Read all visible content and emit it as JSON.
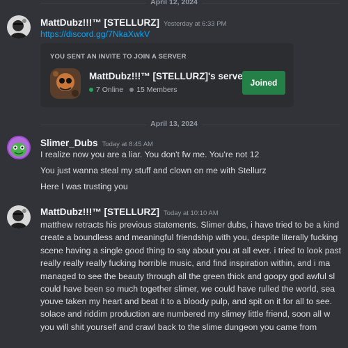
{
  "dividers": [
    "April 12, 2024",
    "April 13, 2024"
  ],
  "messages": [
    {
      "username": "MattDubz!!!™ [STELLURZ]",
      "timestamp": "Yesterday at 6:33 PM",
      "lines": [
        "https://discord.gg/7NkaXwkV"
      ],
      "avatar_icon": "user-avatar"
    },
    {
      "username": "Slimer_Dubs",
      "timestamp": "Today at 8:45 AM",
      "lines": [
        "I realize now you are a liar. You don't fw me. You're not 12",
        "You just wanna steal my stuff and clown on me with Stellurz",
        "Here I was trusting you"
      ],
      "avatar_icon": "slime-avatar"
    },
    {
      "username": "MattDubz!!!™ [STELLURZ]",
      "timestamp": "Today at 10:10 AM",
      "lines": [
        "matthew retracts his previous statements. Slimer dubs, i have tried to be a kind",
        "create a boundless and meaningful friendship with you, despite literally fucking",
        "scene having a single good thing to say about you at all ever. i tried to look past",
        "really really really fucking horrible music, and find inspiration within, and i ma",
        "managed to see the beauty through all the green thick and goopy god awful sl",
        "could have been so much together slimer, we could have rulled the world, sea",
        "youve taken my heart and beat it to a bloody pulp, and spit on it for all to see.",
        "solace and riddim production are numbered my slimey little friend, soon all w",
        "you will shit yourself and crawl back to the slime dungeon you came from"
      ],
      "avatar_icon": "user-avatar"
    }
  ],
  "invite": {
    "heading": "YOU SENT AN INVITE TO JOIN A SERVER",
    "server_name": "MattDubz!!!™ [STELLURZ]'s server",
    "online": "7 Online",
    "members": "15 Members",
    "button": "Joined",
    "online_color": "#23a55a",
    "members_color": "#80848e"
  },
  "colors": {
    "background": "#313338",
    "link": "#00a8fc",
    "button": "#248046"
  }
}
